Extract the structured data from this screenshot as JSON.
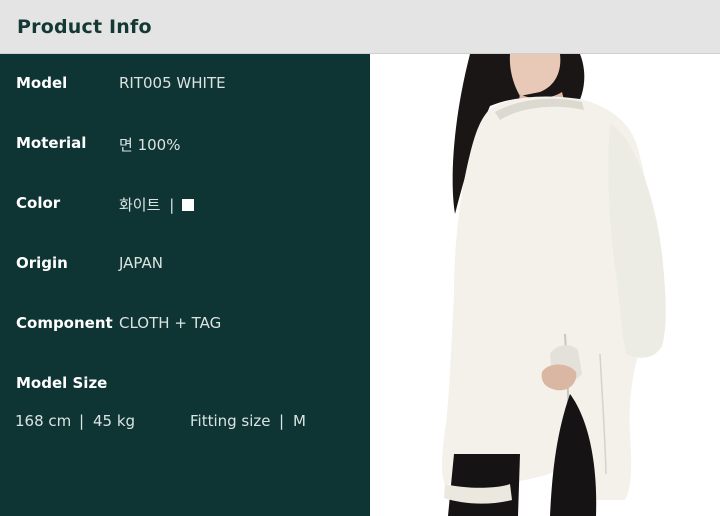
{
  "header": {
    "title": "Product Info"
  },
  "specs": {
    "model_label": "Model",
    "model_value": "RIT005 WHITE",
    "material_label": "Moterial",
    "material_value": "면 100%",
    "color_label": "Color",
    "color_value": "화이트",
    "color_separator": "|",
    "color_swatch_hex": "#ffffff",
    "origin_label": "Origin",
    "origin_value": "JAPAN",
    "component_label": "Component",
    "component_value": "CLOTH + TAG",
    "model_size_label": "Model Size"
  },
  "model_size": {
    "height": "168 cm",
    "sep1": "|",
    "weight": "45 kg",
    "fitting_label": "Fitting size",
    "sep2": "|",
    "fitting_value": "M"
  },
  "colors": {
    "panel": "#0e3534",
    "header": "#e4e4e4",
    "header_text": "#143834"
  }
}
